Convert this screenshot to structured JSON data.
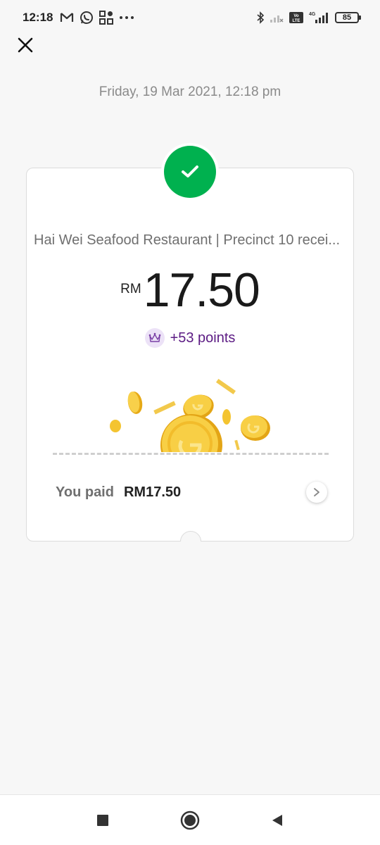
{
  "status_bar": {
    "time": "12:18",
    "left_icons": [
      "gmail-icon",
      "whatsapp-icon",
      "apps-icon",
      "more-icon"
    ],
    "right_icons": [
      "bluetooth-icon",
      "signal-weak-icon",
      "volte-icon",
      "signal-4g-icon",
      "battery-icon"
    ],
    "network": "4G",
    "volte": "Vo LTE",
    "battery": "85"
  },
  "header": {
    "close_icon": "close-icon"
  },
  "date": "Friday, 19 Mar 2021, 12:18 pm",
  "receipt": {
    "status_icon": "check-icon",
    "merchant": "Hai Wei Seafood Restaurant | Precinct 10 recei...",
    "currency": "RM",
    "amount": "17.50",
    "points": "+53 points",
    "points_icon": "crown-icon",
    "paid_label": "You paid",
    "paid_amount": "RM17.50"
  },
  "colors": {
    "success": "#00b14f",
    "points": "#5b1a83",
    "coin": "#f4c430"
  },
  "nav": {
    "icons": [
      "recent-apps-icon",
      "home-icon",
      "back-icon"
    ]
  }
}
